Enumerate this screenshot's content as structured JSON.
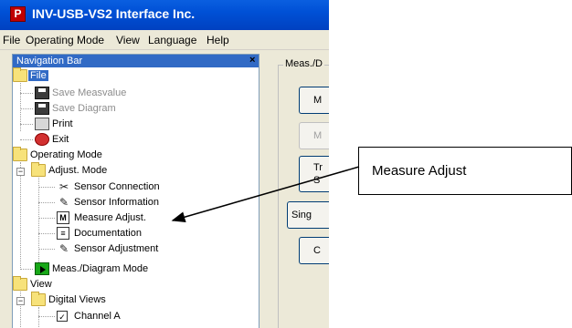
{
  "window": {
    "title": "INV-USB-VS2 Interface Inc.",
    "app_icon_text": "P"
  },
  "menu": [
    "File",
    "Operating Mode",
    "View",
    "Language",
    "Help"
  ],
  "nav": {
    "header": "Navigation Bar",
    "close": "×",
    "tree": {
      "file": "File",
      "save_measvalue": "Save Measvalue",
      "save_diagram": "Save Diagram",
      "print": "Print",
      "exit": "Exit",
      "operating_mode": "Operating Mode",
      "adjust_mode": "Adjust. Mode",
      "sensor_connection": "Sensor Connection",
      "sensor_information": "Sensor Information",
      "measure_adjust": "Measure Adjust.",
      "documentation": "Documentation",
      "sensor_adjustment": "Sensor Adjustment",
      "meas_diagram_mode": "Meas./Diagram Mode",
      "view": "View",
      "digital_views": "Digital Views",
      "channel_a": "Channel A"
    }
  },
  "right_panel": {
    "group_title": "Meas./D",
    "buttons": [
      "M",
      "M",
      "Tr\nS",
      "Sing",
      "C"
    ]
  },
  "callout": {
    "text": "Measure Adjust"
  }
}
